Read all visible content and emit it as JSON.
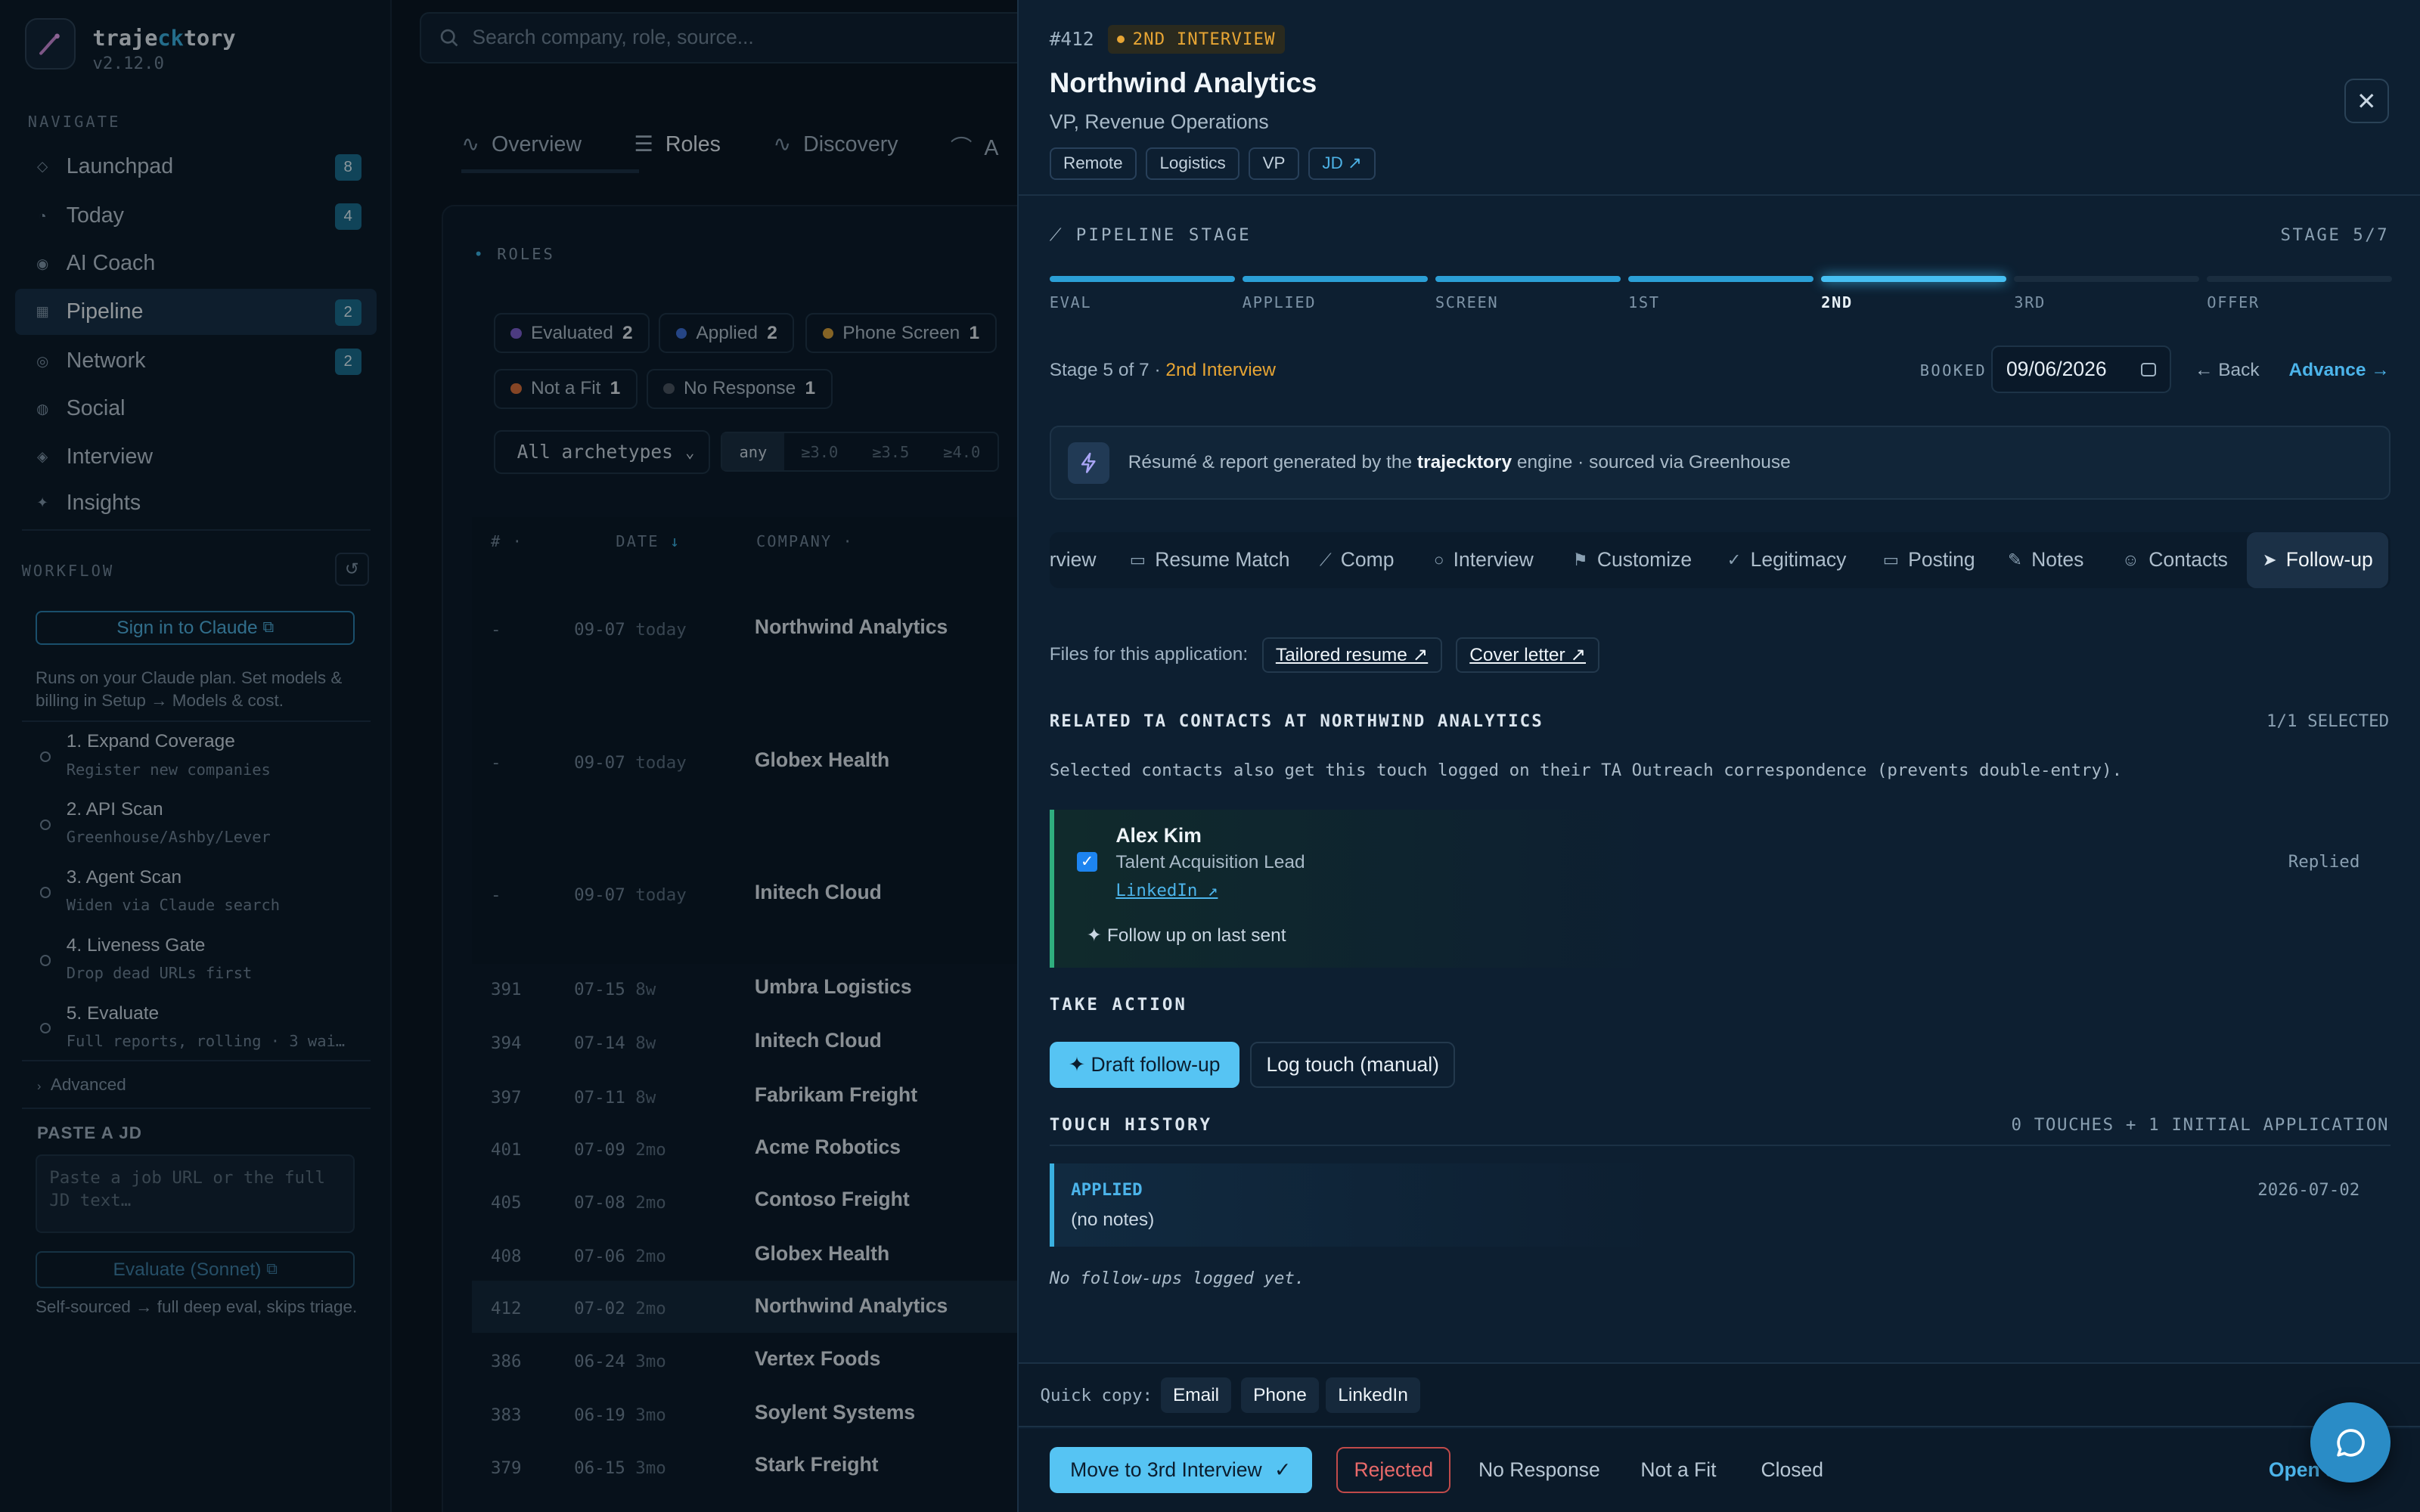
{
  "app": {
    "name_pre": "traje",
    "name_ck": "ck",
    "name_post": "tory",
    "version": "v2.12.0"
  },
  "sidebar": {
    "navigate_label": "NAVIGATE",
    "nav": [
      {
        "label": "Launchpad",
        "count": "8"
      },
      {
        "label": "Today",
        "count": "4"
      },
      {
        "label": "AI Coach",
        "count": ""
      },
      {
        "label": "Pipeline",
        "count": "2"
      },
      {
        "label": "Network",
        "count": "2"
      },
      {
        "label": "Social",
        "count": ""
      },
      {
        "label": "Interview",
        "count": ""
      },
      {
        "label": "Insights",
        "count": ""
      }
    ],
    "workflow_label": "WORKFLOW",
    "signin": "Sign in to Claude",
    "plan_note": "Runs on your Claude plan. Set models & billing in Setup → Models & cost.",
    "steps": [
      {
        "title": "1. Expand Coverage",
        "sub": "Register new companies"
      },
      {
        "title": "2. API Scan",
        "sub": "Greenhouse/Ashby/Lever"
      },
      {
        "title": "3. Agent Scan",
        "sub": "Widen via Claude search"
      },
      {
        "title": "4. Liveness Gate",
        "sub": "Drop dead URLs first"
      },
      {
        "title": "5. Evaluate",
        "sub": "Full reports, rolling · 3 wai…"
      }
    ],
    "advanced": "Advanced",
    "paste_label": "PASTE A JD",
    "paste_placeholder": "Paste a job URL or the full JD text…",
    "evaluate": "Evaluate (Sonnet)",
    "self_note": "Self-sourced → full deep eval, skips triage."
  },
  "main": {
    "search_placeholder": "Search company, role, source...",
    "tabs": [
      "Overview",
      "Roles",
      "Discovery",
      "A"
    ],
    "roles_label": "ROLES",
    "filters": [
      {
        "label": "Evaluated",
        "count": "2",
        "color": "#7a5fcf"
      },
      {
        "label": "Applied",
        "count": "2",
        "color": "#3b6fd6"
      },
      {
        "label": "Phone Screen",
        "count": "1",
        "color": "#d6a23b"
      },
      {
        "label": "Not a Fit",
        "count": "1",
        "color": "#d6703b"
      },
      {
        "label": "No Response",
        "count": "1",
        "color": "#4a5563"
      }
    ],
    "archetype": "All archetypes",
    "scores": [
      "any",
      "≥3.0",
      "≥3.5",
      "≥4.0"
    ],
    "columns": [
      "#",
      "DATE",
      "COMPANY"
    ],
    "rows": [
      {
        "n": "-",
        "date": "09-07",
        "age": "today",
        "company": "Northwind Analytics"
      },
      {
        "n": "-",
        "date": "09-07",
        "age": "today",
        "company": "Globex Health"
      },
      {
        "n": "-",
        "date": "09-07",
        "age": "today",
        "company": "Initech Cloud"
      },
      {
        "n": "391",
        "date": "07-15",
        "age": "8w",
        "company": "Umbra Logistics"
      },
      {
        "n": "394",
        "date": "07-14",
        "age": "8w",
        "company": "Initech Cloud"
      },
      {
        "n": "397",
        "date": "07-11",
        "age": "8w",
        "company": "Fabrikam Freight"
      },
      {
        "n": "401",
        "date": "07-09",
        "age": "2mo",
        "company": "Acme Robotics"
      },
      {
        "n": "405",
        "date": "07-08",
        "age": "2mo",
        "company": "Contoso Freight"
      },
      {
        "n": "408",
        "date": "07-06",
        "age": "2mo",
        "company": "Globex Health"
      },
      {
        "n": "412",
        "date": "07-02",
        "age": "2mo",
        "company": "Northwind Analytics"
      },
      {
        "n": "386",
        "date": "06-24",
        "age": "3mo",
        "company": "Vertex Foods"
      },
      {
        "n": "383",
        "date": "06-19",
        "age": "3mo",
        "company": "Soylent Systems"
      },
      {
        "n": "379",
        "date": "06-15",
        "age": "3mo",
        "company": "Stark Freight"
      }
    ]
  },
  "drawer": {
    "id": "#412",
    "stage_badge": "2ND INTERVIEW",
    "company": "Northwind Analytics",
    "role": "VP, Revenue Operations",
    "tags": [
      "Remote",
      "Logistics",
      "VP",
      "JD ↗"
    ],
    "pipeline_label": "PIPELINE STAGE",
    "stage_count": "STAGE 5/7",
    "stage_progress": "5/7",
    "stages": [
      "EVAL",
      "APPLIED",
      "SCREEN",
      "1ST",
      "2ND",
      "3RD",
      "OFFER"
    ],
    "stage_line": "Stage 5 of 7 · ",
    "stage_name": "2nd Interview",
    "booked_label": "BOOKED",
    "booked_date": "09/06/2026",
    "back": "← Back",
    "advance": "Advance →",
    "engine_pre": "Résumé & report generated by the ",
    "engine_name": "trajecktory",
    "engine_post": " engine · sourced via Greenhouse",
    "tabs": [
      "rview",
      "Resume Match",
      "Comp",
      "Interview",
      "Customize",
      "Legitimacy",
      "Posting",
      "Notes",
      "Contacts",
      "Follow-up"
    ],
    "files_label": "Files for this application:",
    "files": [
      "Tailored resume ↗",
      "Cover letter ↗"
    ],
    "related_title": "RELATED TA CONTACTS AT NORTHWIND ANALYTICS",
    "selected": "1/1 SELECTED",
    "related_note": "Selected contacts also get this touch logged on their TA Outreach correspondence (prevents double-entry).",
    "contact": {
      "name": "Alex Kim",
      "role": "Talent Acquisition Lead",
      "link": "LinkedIn ↗",
      "status": "Replied",
      "followup": "✦ Follow up on last sent"
    },
    "take_action": "TAKE ACTION",
    "draft": "✦ Draft follow-up",
    "log": "Log touch (manual)",
    "history_title": "TOUCH HISTORY",
    "history_count": "0 TOUCHES + 1 INITIAL APPLICATION",
    "history": {
      "type": "APPLIED",
      "note": "(no notes)",
      "date": "2026-07-02"
    },
    "no_followups": "No follow-ups logged yet.",
    "quick_copy": "Quick copy:",
    "copy_buttons": [
      "Email",
      "Phone",
      "LinkedIn"
    ],
    "move": "Move to 3rd Interview",
    "rejected": "Rejected",
    "actions": [
      "No Response",
      "Not a Fit",
      "Closed"
    ],
    "open": "Open J"
  }
}
